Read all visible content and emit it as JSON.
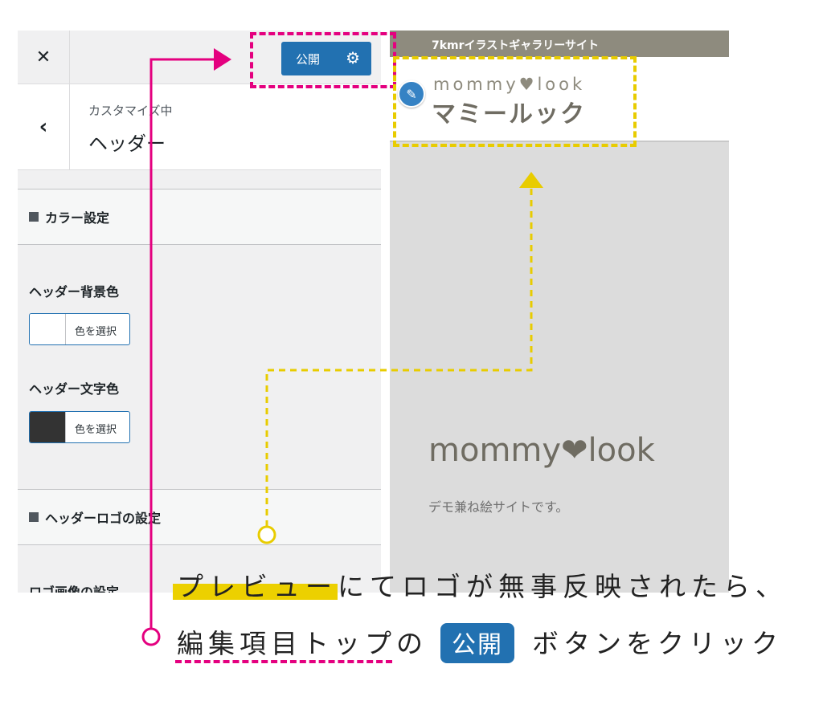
{
  "panel": {
    "close_label": "✕",
    "publish_label": "公開",
    "gear_icon": "⚙",
    "back_label": "‹",
    "heading_sub": "カスタマイズ中",
    "heading_title": "ヘッダー",
    "sections": {
      "color": "カラー設定",
      "logo": "ヘッダーロゴの設定"
    },
    "controls": {
      "bg_label": "ヘッダー背景色",
      "bg_button": "色を選択",
      "text_label": "ヘッダー文字色",
      "text_button": "色を選択",
      "logo_image_label": "ロゴ画像の設定"
    },
    "swatches": {
      "bg": "#ffffff",
      "text": "#333333"
    }
  },
  "preview": {
    "topbar_text": "7kmrイラストギャラリーサイト",
    "logo_top": "mommy♥look",
    "logo_bottom": "マミールック",
    "hero_title": "mommy❤look",
    "hero_subtitle": "デモ兼ね絵サイトです。"
  },
  "annotation": {
    "line1": "プレビューにてロゴが無事反映されたら、",
    "line2_start": "編集項目トップの",
    "line2_badge": "公開",
    "line2_end": "ボタンをクリック"
  },
  "colors": {
    "accent_blue": "#2271b1",
    "pink": "#e4007f",
    "yellow": "#e8cc00"
  }
}
